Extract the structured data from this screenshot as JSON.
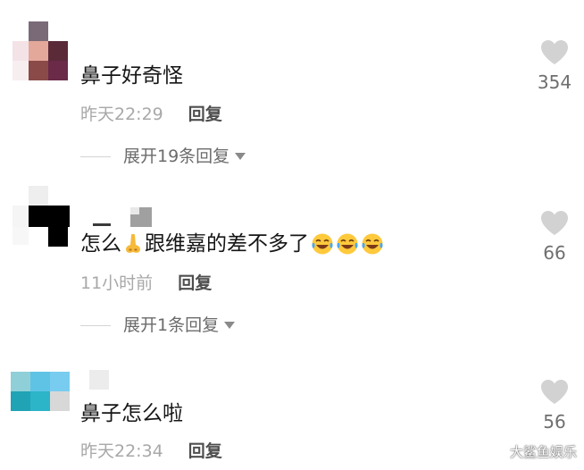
{
  "comments": [
    {
      "text": "鼻子好奇怪",
      "time": "昨天22:29",
      "reply_label": "回复",
      "expand_label": "展开19条回复",
      "likes": "354"
    },
    {
      "text": "怎么👃跟维嘉的差不多了",
      "text_before_nose": "怎么",
      "text_after_nose": "跟维嘉的差不多了",
      "emoji_icons": [
        "laugh-cry-icon",
        "laugh-cry-icon",
        "laugh-cry-icon"
      ],
      "time": "11小时前",
      "reply_label": "回复",
      "expand_label": "展开1条回复",
      "likes": "66"
    },
    {
      "text": "鼻子怎么啦",
      "time": "昨天22:34",
      "reply_label": "回复",
      "likes": "56"
    }
  ],
  "watermark": "大鲨鱼娱乐",
  "icons": {
    "like": "heart-icon",
    "expand": "caret-down-icon",
    "nose": "nose-emoji-icon"
  },
  "colors": {
    "heart": "#d2d2d2",
    "time": "#a8a8a8",
    "reply": "#4e4e4e",
    "text": "#161616"
  }
}
